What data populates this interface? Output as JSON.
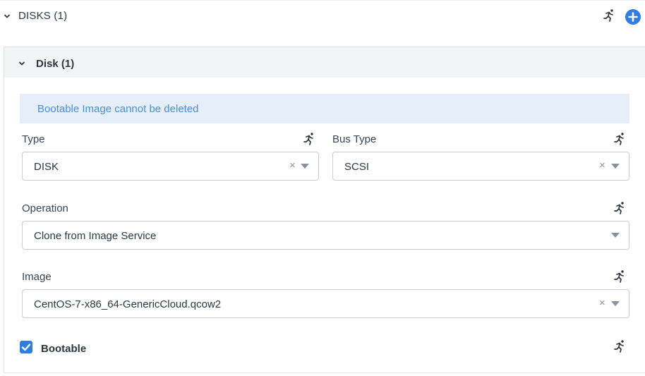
{
  "section": {
    "title": "DISKS (1)",
    "icon_toggle": "chevron-down-icon",
    "icon_runtime": "runtime-icon",
    "icon_add": "plus-circle-icon"
  },
  "disk": {
    "title": "Disk (1)",
    "banner": "Bootable Image cannot be deleted",
    "type": {
      "label": "Type",
      "value": "DISK"
    },
    "bus_type": {
      "label": "Bus Type",
      "value": "SCSI"
    },
    "operation": {
      "label": "Operation",
      "value": "Clone from Image Service"
    },
    "image": {
      "label": "Image",
      "value": "CentOS-7-x86_64-GenericCloud.qcow2"
    },
    "bootable": {
      "label": "Bootable",
      "checked": true
    }
  },
  "colors": {
    "accent": "#2e7fe0",
    "banner_bg": "#e6eff9",
    "banner_text": "#4a8fd8",
    "header_bg": "#f2f4f6"
  }
}
